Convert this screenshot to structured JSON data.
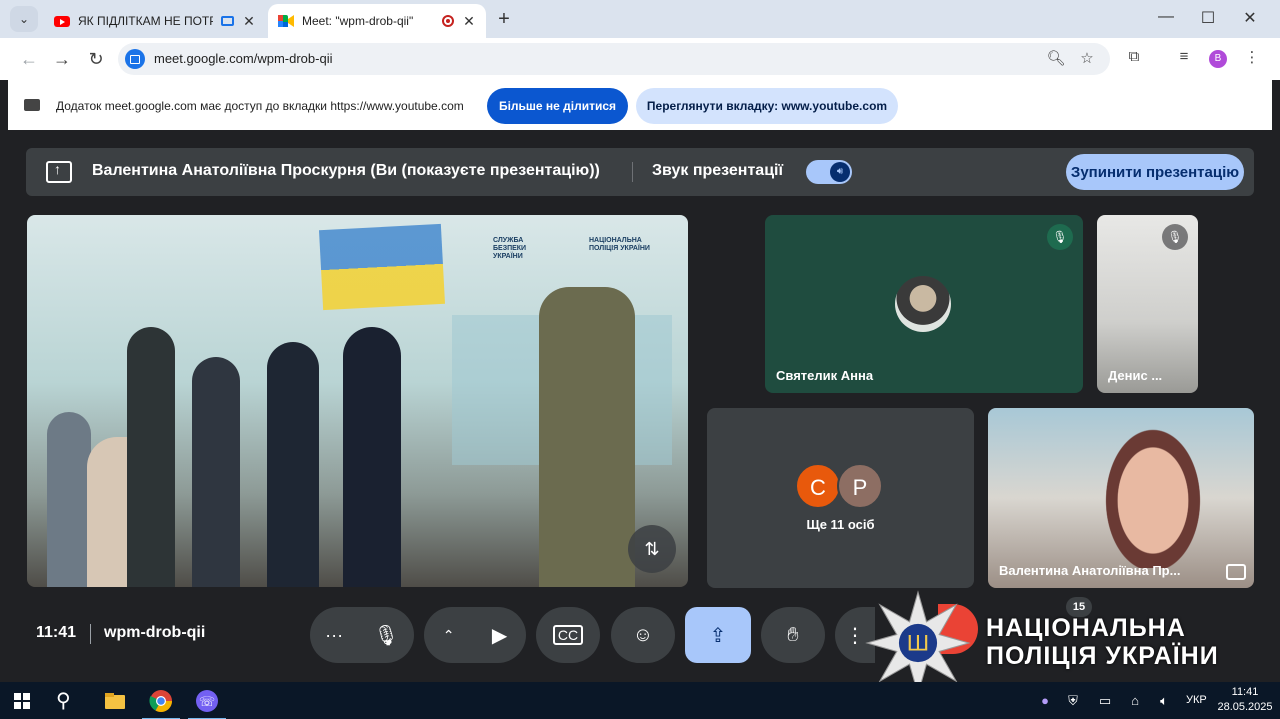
{
  "browser": {
    "tabs": [
      {
        "title": "ЯК ПІДЛІТКАМ НЕ ПОТРАПИТИ",
        "favicon": "youtube-icon",
        "active": false
      },
      {
        "title": "Meet: \"wpm-drob-qii\"",
        "favicon": "google-meet-icon",
        "active": true
      }
    ],
    "url": "meet.google.com/wpm-drob-qii",
    "profile_initial": "B"
  },
  "infobar": {
    "message": "Додаток meet.google.com має доступ до вкладки https://www.youtube.com",
    "stop_sharing_label": "Більше не ділитися",
    "view_tab_label": "Переглянути вкладку: www.youtube.com"
  },
  "presentation": {
    "presenter_text": "Валентина Анатоліївна Проскурня (Ви (показуєте презентацію))",
    "sound_label": "Звук презентації",
    "stop_label": "Зупинити презентацію"
  },
  "main_video": {
    "logo_sbu": "СЛУЖБА БЕЗПЕКИ УКРАЇНИ",
    "logo_police": "НАЦІОНАЛЬНА ПОЛІЦІЯ УКРАЇНИ"
  },
  "participants": [
    {
      "name": "Святелик Анна",
      "muted": true
    },
    {
      "name": "Денис ...",
      "muted": true
    },
    {
      "name": "Валентина Анатоліївна Пр...",
      "muted": false
    }
  ],
  "others": {
    "avatars": [
      {
        "initial": "С",
        "color": "#e8590c"
      },
      {
        "initial": "Р",
        "color": "#8d6e63"
      }
    ],
    "label": "Ще 11 осіб"
  },
  "controls": {
    "time": "11:41",
    "meeting_code": "wpm-drob-qii",
    "participants_count": "15"
  },
  "watermark": {
    "line1": "НАЦІОНАЛЬНА",
    "line2": "ПОЛІЦІЯ УКРАЇНИ"
  },
  "taskbar": {
    "language": "УКР",
    "time": "11:41",
    "date": "28.05.2025"
  },
  "colors": {
    "meet_bg": "#202124",
    "tile_bg": "#3c4043",
    "accent_blue": "#a8c7fa",
    "chrome_blue": "#0b57d0"
  }
}
